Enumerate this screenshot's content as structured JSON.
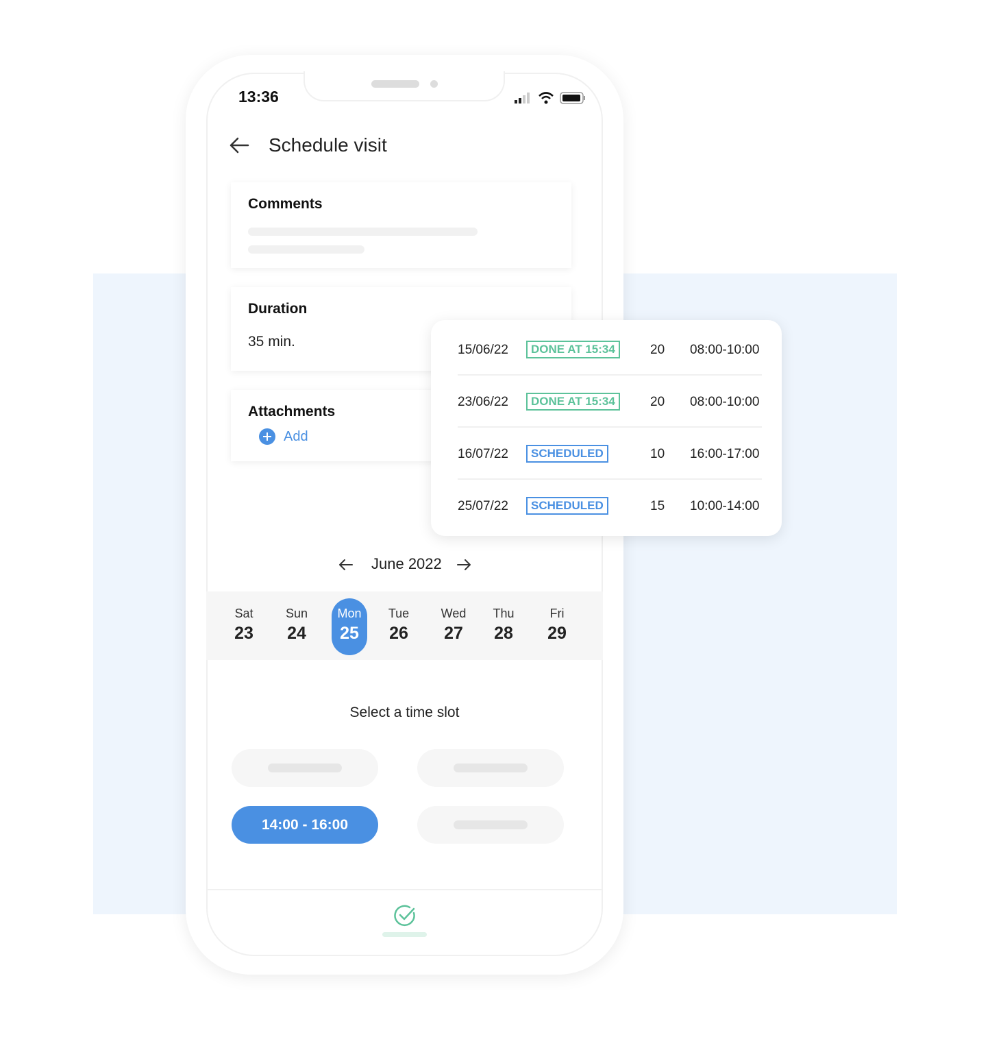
{
  "status_bar": {
    "time": "13:36"
  },
  "header": {
    "title": "Schedule visit",
    "back_icon": "arrow-left-icon"
  },
  "comments": {
    "title": "Comments"
  },
  "duration": {
    "title": "Duration",
    "value": "35 min."
  },
  "attachments": {
    "title": "Attachments",
    "add_label": "Add"
  },
  "visits": [
    {
      "date": "15/06/22",
      "status": "DONE AT 15:34",
      "status_type": "done",
      "count": "20",
      "time": "08:00-10:00"
    },
    {
      "date": "23/06/22",
      "status": "DONE AT 15:34",
      "status_type": "done",
      "count": "20",
      "time": "08:00-10:00"
    },
    {
      "date": "16/07/22",
      "status": "SCHEDULED",
      "status_type": "scheduled",
      "count": "10",
      "time": "16:00-17:00"
    },
    {
      "date": "25/07/22",
      "status": "SCHEDULED",
      "status_type": "scheduled",
      "count": "15",
      "time": "10:00-14:00"
    }
  ],
  "calendar": {
    "month": "June 2022",
    "days": [
      {
        "name": "Sat",
        "num": "23"
      },
      {
        "name": "Sun",
        "num": "24"
      },
      {
        "name": "Mon",
        "num": "25",
        "selected": true
      },
      {
        "name": "Tue",
        "num": "26"
      },
      {
        "name": "Wed",
        "num": "27"
      },
      {
        "name": "Thu",
        "num": "28"
      },
      {
        "name": "Fri",
        "num": "29"
      }
    ]
  },
  "slots": {
    "title": "Select a time slot",
    "selected": "14:00 - 16:00"
  },
  "colors": {
    "accent": "#4a90e2",
    "done": "#5cc29a",
    "panel": "#eef5fd"
  }
}
